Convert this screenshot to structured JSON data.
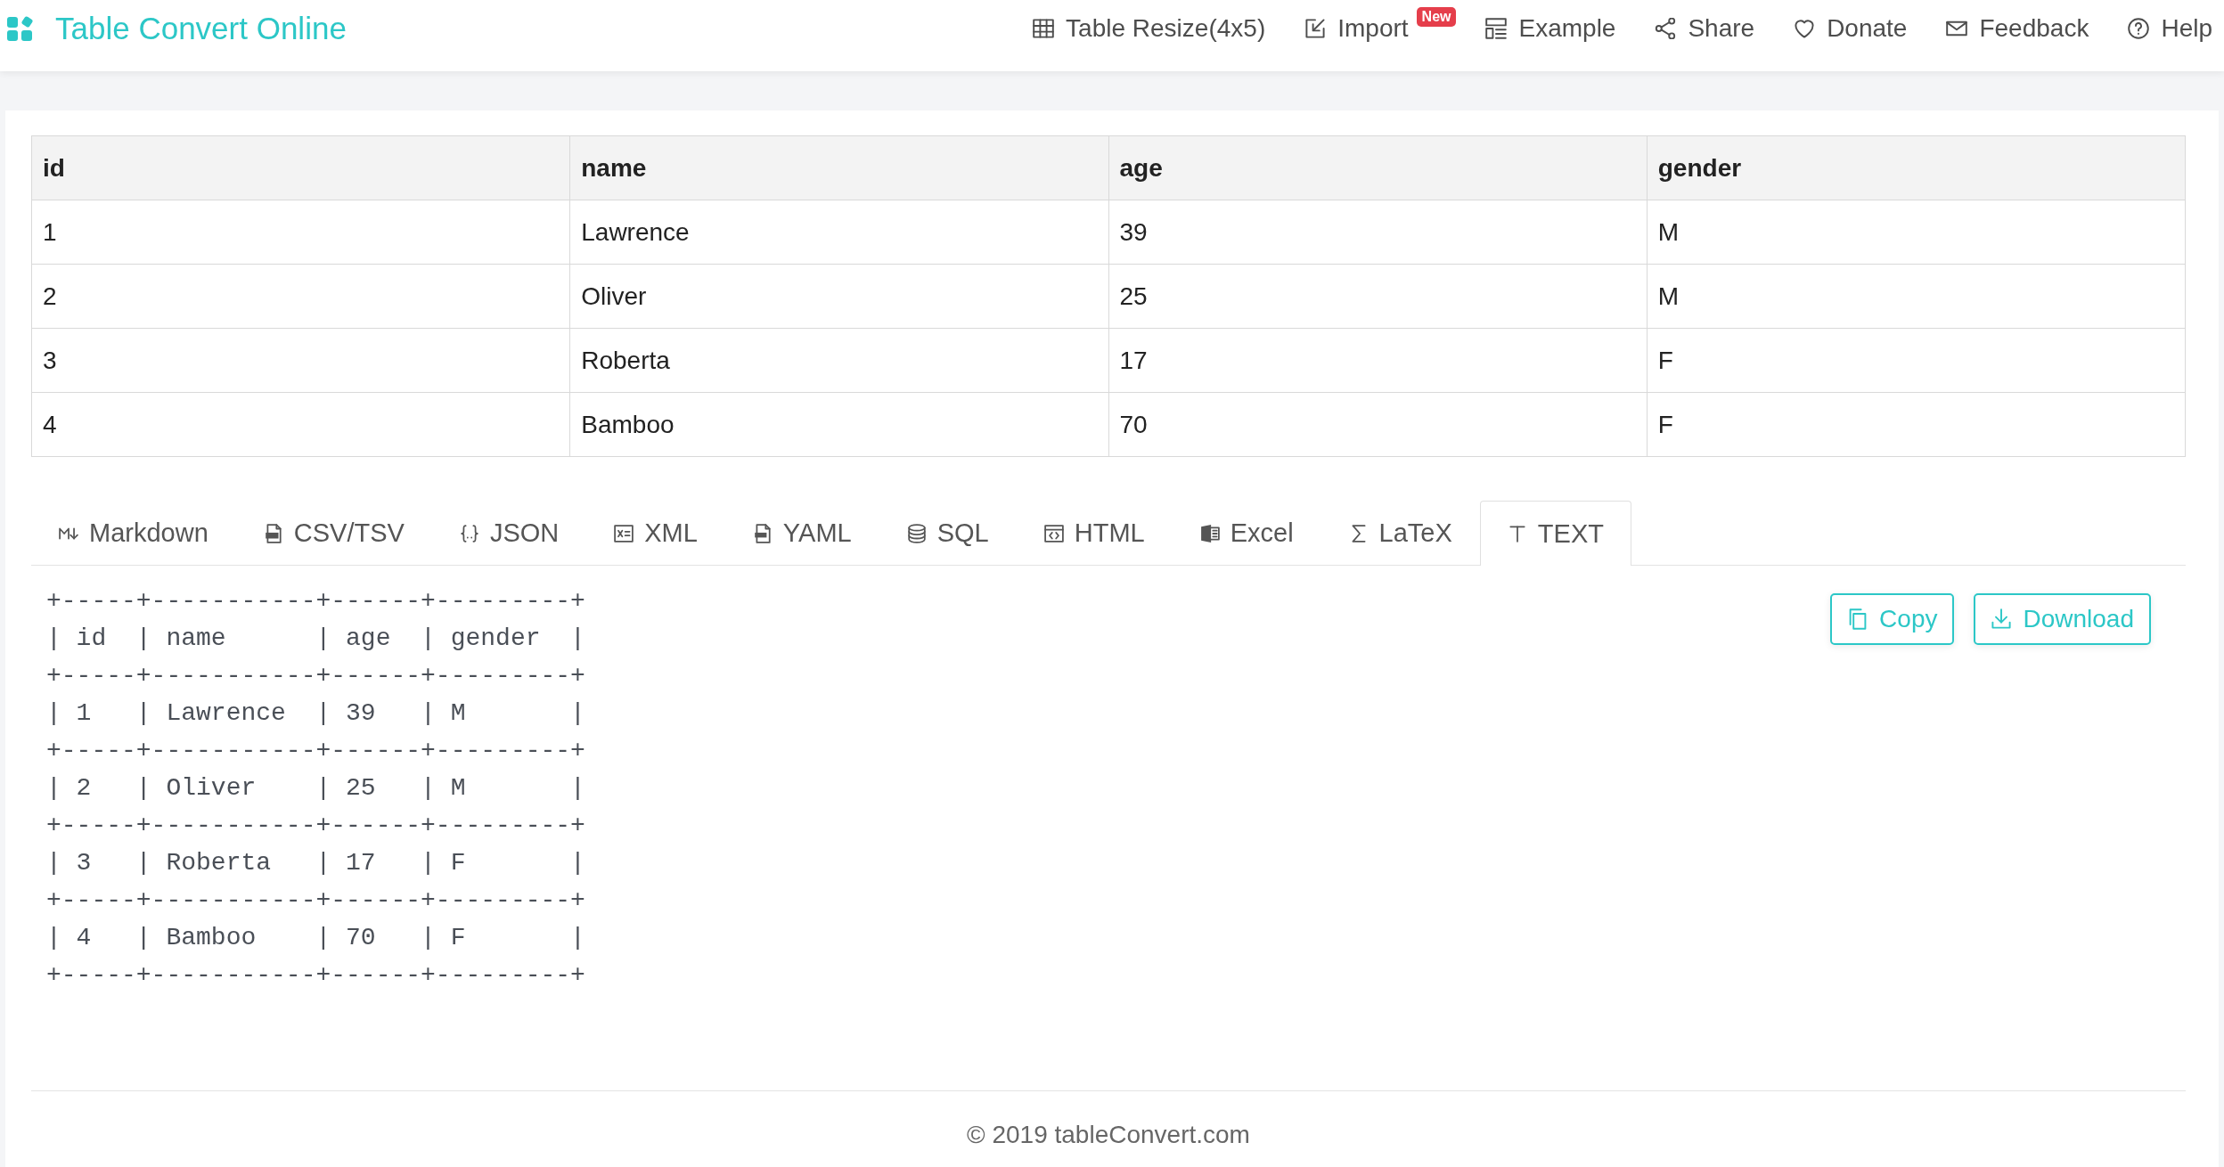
{
  "header": {
    "title": "Table Convert Online",
    "nav": [
      {
        "label": "Table Resize(4x5)"
      },
      {
        "label": "Import",
        "badge": "New"
      },
      {
        "label": "Example"
      },
      {
        "label": "Share"
      },
      {
        "label": "Donate"
      },
      {
        "label": "Feedback"
      },
      {
        "label": "Help"
      }
    ]
  },
  "table": {
    "columns": [
      "id",
      "name",
      "age",
      "gender"
    ],
    "rows": [
      [
        "1",
        "Lawrence",
        "39",
        "M"
      ],
      [
        "2",
        "Oliver",
        "25",
        "M"
      ],
      [
        "3",
        "Roberta",
        "17",
        "F"
      ],
      [
        "4",
        "Bamboo",
        "70",
        "F"
      ]
    ]
  },
  "tabs": [
    {
      "label": "Markdown",
      "selected": false
    },
    {
      "label": "CSV/TSV",
      "selected": false
    },
    {
      "label": "JSON",
      "selected": false
    },
    {
      "label": "XML",
      "selected": false
    },
    {
      "label": "YAML",
      "selected": false
    },
    {
      "label": "SQL",
      "selected": false
    },
    {
      "label": "HTML",
      "selected": false
    },
    {
      "label": "Excel",
      "selected": false
    },
    {
      "label": "LaTeX",
      "selected": false
    },
    {
      "label": "TEXT",
      "selected": true
    }
  ],
  "output": {
    "text": "+-----+-----------+------+---------+\n| id  | name      | age  | gender  |\n+-----+-----------+------+---------+\n| 1   | Lawrence  | 39   | M       |\n+-----+-----------+------+---------+\n| 2   | Oliver    | 25   | M       |\n+-----+-----------+------+---------+\n| 3   | Roberta   | 17   | F       |\n+-----+-----------+------+---------+\n| 4   | Bamboo    | 70   | F       |\n+-----+-----------+------+---------+"
  },
  "actions": [
    {
      "label": "Copy"
    },
    {
      "label": "Download"
    }
  ],
  "footer": {
    "copyright": "© 2019 tableConvert.com"
  }
}
